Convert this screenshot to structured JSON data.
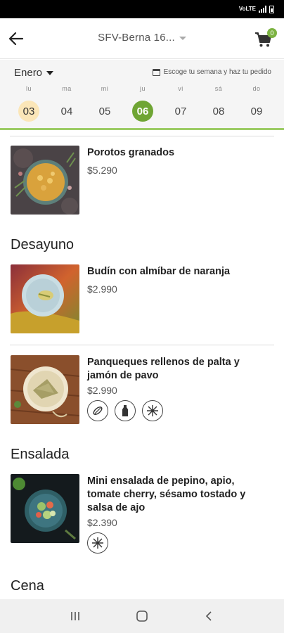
{
  "status_bar": {
    "network_text": "VoLTE"
  },
  "header": {
    "store_name": "SFV-Berna 16...",
    "cart_count": "0"
  },
  "calendar": {
    "month": "Enero",
    "week_hint": "Escoge tu semana y haz tu pedido",
    "days": [
      {
        "name": "lu",
        "num": "03",
        "state": "today"
      },
      {
        "name": "ma",
        "num": "04",
        "state": ""
      },
      {
        "name": "mi",
        "num": "05",
        "state": ""
      },
      {
        "name": "ju",
        "num": "06",
        "state": "selected"
      },
      {
        "name": "vi",
        "num": "07",
        "state": ""
      },
      {
        "name": "sá",
        "num": "08",
        "state": ""
      },
      {
        "name": "do",
        "num": "09",
        "state": ""
      }
    ]
  },
  "menu": {
    "item_porotos": {
      "name": "Porotos granados",
      "price": "$5.290"
    },
    "section_desayuno": "Desayuno",
    "item_budin": {
      "name": "Budín con almíbar de naranja",
      "price": "$2.990"
    },
    "item_panqueques": {
      "name": "Panqueques rellenos de palta y jamón de pavo",
      "price": "$2.990",
      "tags": [
        "gluten-icon",
        "dairy-bottle-icon",
        "frozen-icon"
      ]
    },
    "section_ensalada": "Ensalada",
    "item_ensalada": {
      "name": "Mini ensalada de pepino, apio, tomate cherry, sésamo tostado y salsa de ajo",
      "price": "$2.390",
      "tags": [
        "frozen-icon"
      ]
    },
    "section_cena": "Cena"
  },
  "colors": {
    "accent": "#6fa534",
    "today": "#fbe6b8",
    "underline": "#9ccc65"
  }
}
